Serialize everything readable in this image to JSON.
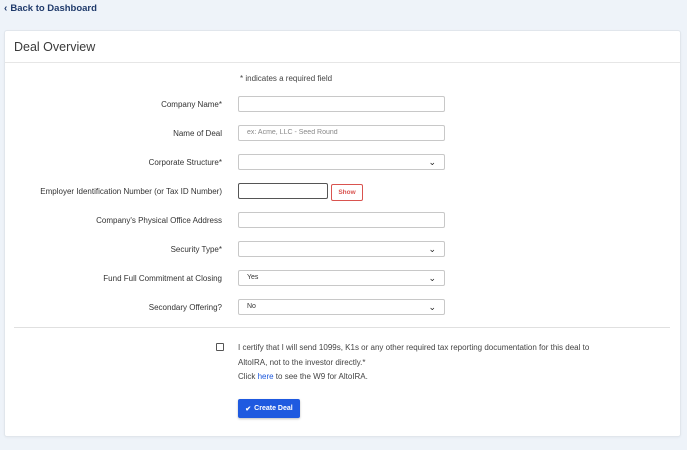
{
  "nav": {
    "back_label": "Back to Dashboard"
  },
  "card": {
    "title": "Deal Overview"
  },
  "form": {
    "required_note": "* indicates a required field",
    "fields": [
      {
        "label": "Company Name*",
        "value": "",
        "placeholder": ""
      },
      {
        "label": "Name of Deal",
        "value": "",
        "placeholder": "ex: Acme, LLC - Seed Round"
      },
      {
        "label": "Corporate Structure*",
        "value": ""
      },
      {
        "label": "Employer Identification Number (or Tax ID Number)",
        "value": "",
        "show_label": "Show"
      },
      {
        "label": "Company's Physical Office Address",
        "value": ""
      },
      {
        "label": "Security Type*",
        "value": ""
      },
      {
        "label": "Fund Full Commitment at Closing",
        "value": "Yes"
      },
      {
        "label": "Secondary Offering?",
        "value": "No"
      }
    ]
  },
  "certify": {
    "text": "I certify that I will send 1099s, K1s or any other required tax reporting documentation for this deal to AltoIRA, not to the investor directly.*",
    "click_prefix": "Click ",
    "here_label": "here",
    "click_suffix": " to see the W9 for AltoIRA."
  },
  "actions": {
    "create_label": "Create Deal"
  },
  "icons": {
    "back": "chevron-left-icon",
    "caret": "chevron-down-icon",
    "check": "check-icon"
  },
  "colors": {
    "primary": "#1f5ae0",
    "danger": "#d9534f",
    "background": "#eef3f9",
    "link": "#1a56db"
  }
}
